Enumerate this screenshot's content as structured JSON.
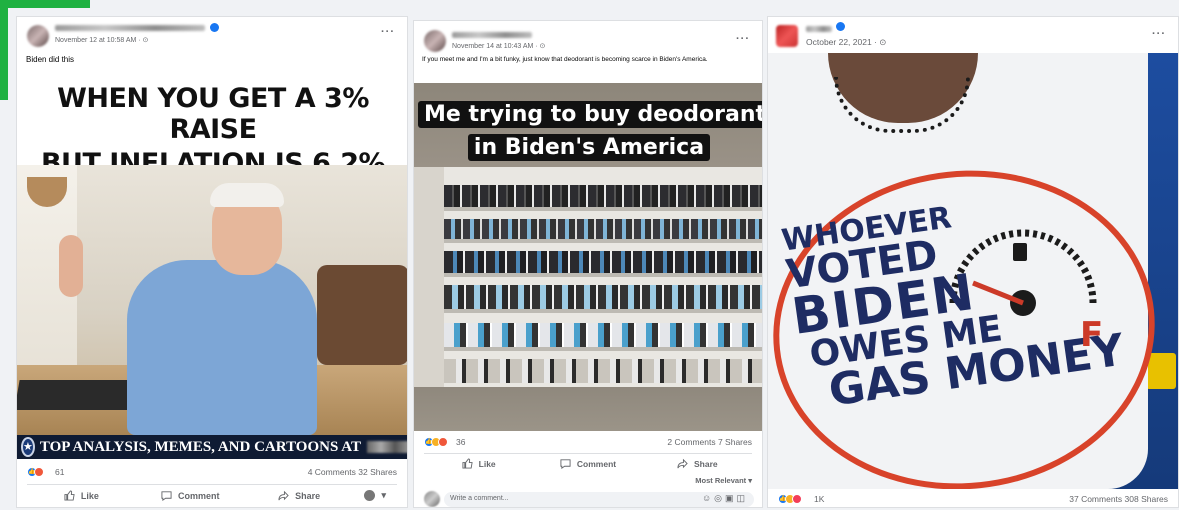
{
  "colors": {
    "accent_green": "#1fb141",
    "facebook_blue": "#1877f2",
    "gray_text": "#65676b"
  },
  "posts": [
    {
      "timestamp": "November 12 at 10:58 AM · ",
      "caption": "Biden did this",
      "meme_line1": "WHEN YOU GET A 3% RAISE",
      "meme_line2": "BUT INFLATION IS 6.2%",
      "banner": "TOP ANALYSIS, MEMES, AND CARTOONS AT",
      "reaction_count": "61",
      "comments_shares": "4 Comments  32 Shares",
      "like_label": "Like",
      "comment_label": "Comment",
      "share_label": "Share",
      "more_label": "···"
    },
    {
      "timestamp": "November 14 at 10:43 AM · ",
      "caption": "If you meet me and I'm a bit funky, just know that deodorant is becoming scarce in Biden's America.",
      "meme_line1": "Me trying to buy deodorant",
      "meme_line2": "in Biden's America",
      "reaction_count": "36",
      "comments_shares": "2 Comments  7 Shares",
      "like_label": "Like",
      "comment_label": "Comment",
      "share_label": "Share",
      "sort_label": "Most Relevant ▾",
      "comment_placeholder": "Write a comment...",
      "more_label": "···"
    },
    {
      "timestamp": "October 22, 2021 · ",
      "shirt_line1": "WHOEVER",
      "shirt_line2": "VOTED",
      "shirt_line3": "BIDEN",
      "shirt_line4": "OWES ME",
      "shirt_line5": "GAS MONEY",
      "gauge_f": "F",
      "reaction_count": "1K",
      "comments_shares": "37 Comments  308 Shares",
      "more_label": "···"
    }
  ]
}
